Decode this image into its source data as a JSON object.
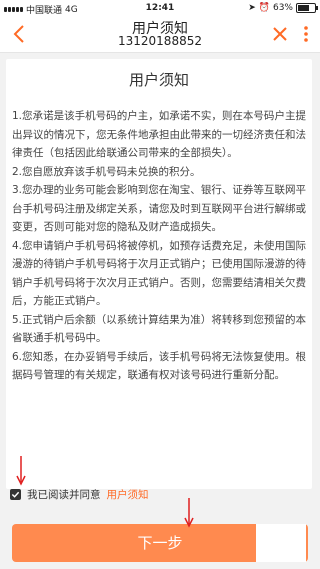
{
  "status_bar": {
    "carrier": "中国联通",
    "network": "4G",
    "time": "12:41",
    "battery": "63%"
  },
  "header": {
    "title": "用户须知",
    "subtitle": "13120188852",
    "accent_color": "#ff6a25"
  },
  "notice": {
    "title": "用户须知",
    "paragraphs": [
      "1.您承诺是该手机号码的户主，如承诺不实，则在本号码户主提出异议的情况下，您无条件地承担由此带来的一切经济责任和法律责任（包括因此给联通公司带来的全部损失）。",
      "2.您自愿放弃该手机号码未兑换的积分。",
      "3.您办理的业务可能会影响到您在淘宝、银行、证券等互联网平台手机号码注册及绑定关系，请您及时到互联网平台进行解绑或变更，否则可能对您的隐私及财产造成损失。",
      "4.您申请销户手机号码将被停机，如预存话费充足，未使用国际漫游的待销户手机号码将于次月正式销户；已使用国际漫游的待销户手机号码将于次次月正式销户。否则，您需要结清相关欠费后，方能正式销户。",
      "5.正式销户后余额（以系统计算结果为准）将转移到您预留的本省联通手机号码中。",
      "6.您知悉，在办妥销号手续后，该手机号码将无法恢复使用。根据码号管理的有关规定，联通有权对该号码进行重新分配。"
    ]
  },
  "agreement": {
    "checked": true,
    "text": "我已阅读并同意",
    "link": "用户须知"
  },
  "next_button": {
    "label": "下一步",
    "color": "#ff8a4f"
  }
}
